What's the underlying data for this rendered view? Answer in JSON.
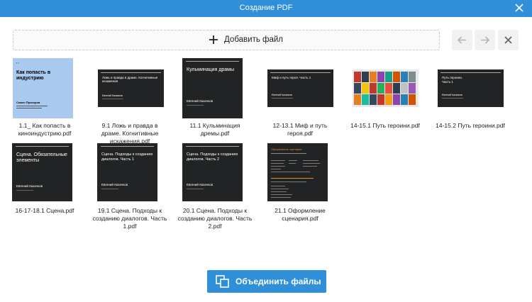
{
  "window": {
    "title": "Создание PDF"
  },
  "toolbar": {
    "add_label": "Добавить файл"
  },
  "files": [
    {
      "name": "1.1_ Как попасть в киноиндустрию.pdf",
      "thumb_title": "Как попасть в индустрию",
      "thumb_author": "Семен Прохоров"
    },
    {
      "name": "9.1 Ложь и правда в драме. Когнитивные искажения.pdf",
      "thumb_title": "Ложь и правда в драме. Когнитивные искажения",
      "thumb_author": "Евгений Казачков"
    },
    {
      "name": "11.1 Кульминация дремы.pdf",
      "thumb_title": "Кульминация драмы",
      "thumb_author": "Евгений Казачков"
    },
    {
      "name": "12-13.1 Миф и путь героя.pdf",
      "thumb_title": "Миф и путь героя. Часть 1",
      "thumb_author": "Евгений Казачков"
    },
    {
      "name": "14-15.1 Путь героини.pdf"
    },
    {
      "name": "14-15.2 Путь героини.pdf",
      "thumb_title": "Путь героини. Часть 1",
      "thumb_author": "Евгений Казачков"
    },
    {
      "name": "16-17-18.1 Сцена.pdf",
      "thumb_title": "Сцена. Обязательные элементы",
      "thumb_author": "Евгений Казачков"
    },
    {
      "name": "19.1 Сцена. Подходы к созданию диалогов. Часть 1.pdf",
      "thumb_title": "Сцена. Подходы к созданию диалогов. Часть 1",
      "thumb_author": "Евгений Казачков"
    },
    {
      "name": "20.1 Сцена. Подходы к созданию диалогов. Часть 2.pdf",
      "thumb_title": "Сцена. Подходы к созданию диалогов. Часть 2",
      "thumb_author": "Евгений Казачков"
    },
    {
      "name": "21.1 Оформление сценария.pdf",
      "thumb_title": "Оформление сценария"
    }
  ],
  "footer": {
    "merge_label": "Объединить файлы"
  },
  "colors": {
    "accent": "#2f8fd8",
    "thumb_dark": "#222324",
    "thumb_blue": "#a9c9ef",
    "thumb_orange": "#e08a2c"
  }
}
